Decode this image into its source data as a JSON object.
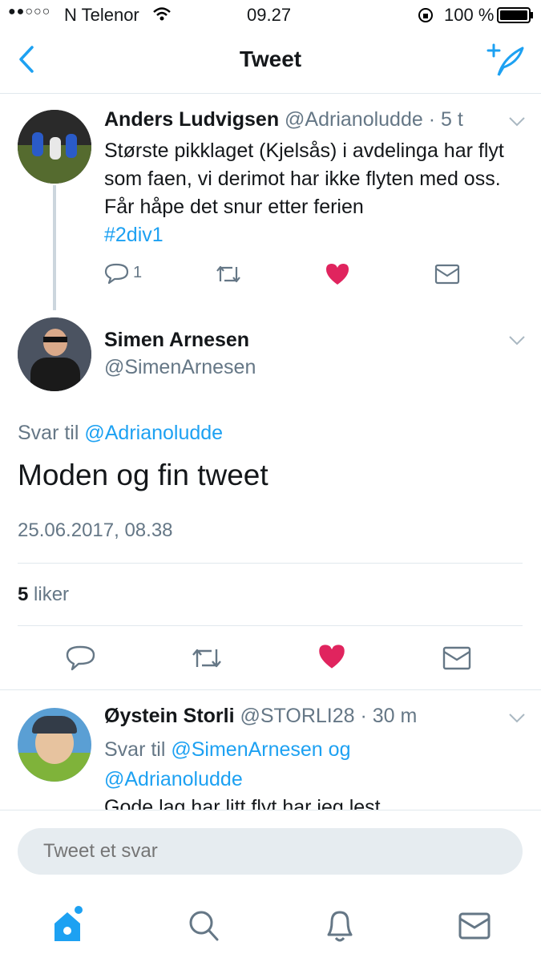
{
  "status_bar": {
    "signal": "●●○○○",
    "carrier": "N Telenor",
    "time": "09.27",
    "battery": "100 %"
  },
  "nav": {
    "title": "Tweet",
    "back_icon": "chevron-left-icon",
    "compose_icon": "compose-tweet-icon"
  },
  "parent_tweet": {
    "name": "Anders Ludvigsen",
    "handle": "@Adrianoludde",
    "time": "· 5 t",
    "text": "Største pikklaget (Kjelsås) i avdelinga har flyt som faen, vi derimot har ikke flyten med oss. Får håpe det snur etter ferien",
    "hashtag": "#2div1",
    "reply_count": "1"
  },
  "main_tweet": {
    "name": "Simen Arnesen",
    "handle": "@SimenArnesen",
    "reply_to_label": "Svar til",
    "reply_to_handle": "@Adrianoludde",
    "text": "Moden og fin tweet",
    "timestamp": "25.06.2017, 08.38",
    "likes_count": "5",
    "likes_label": "liker"
  },
  "reply_tweet": {
    "name": "Øystein Storli",
    "handle": "@STORLI28",
    "time": "· 30 m",
    "reply_to_label": "Svar til",
    "reply_to_handles": "@SimenArnesen og",
    "reply_to_handles_2": "@Adrianoludde",
    "text_partial": "Gode lag har litt flyt har jeg lest"
  },
  "reply_input": {
    "placeholder": "Tweet et svar"
  },
  "colors": {
    "accent": "#1da1f2",
    "like": "#e0245e",
    "gray": "#657786"
  }
}
